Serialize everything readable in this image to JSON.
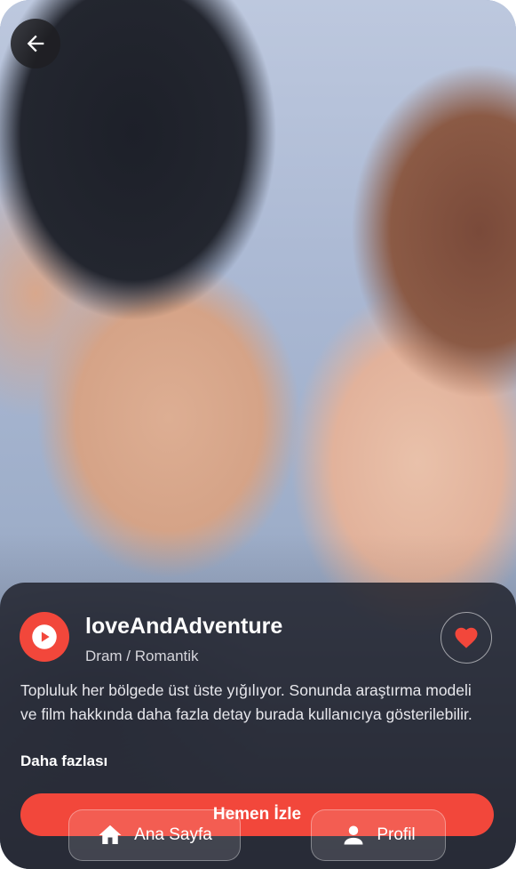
{
  "movie": {
    "title": "loveAndAdventure",
    "genre": "Dram / Romantik",
    "description": "Topluluk her bölgede üst üste yığılıyor. Sonunda araştırma modeli ve film hakkında daha fazla detay burada kullanıcıya gösterilebilir.",
    "more_label": "Daha fazlası"
  },
  "actions": {
    "watch_label": "Hemen İzle"
  },
  "bottom_nav": {
    "home_label": "Ana Sayfa",
    "profile_label": "Profil"
  },
  "icons": {
    "back": "arrow-left-icon",
    "play": "play-circle-icon",
    "favorite": "heart-icon",
    "home": "home-icon",
    "profile": "person-icon"
  },
  "colors": {
    "accent": "#f2473b",
    "panel": "#22242e",
    "text": "#ffffff"
  }
}
